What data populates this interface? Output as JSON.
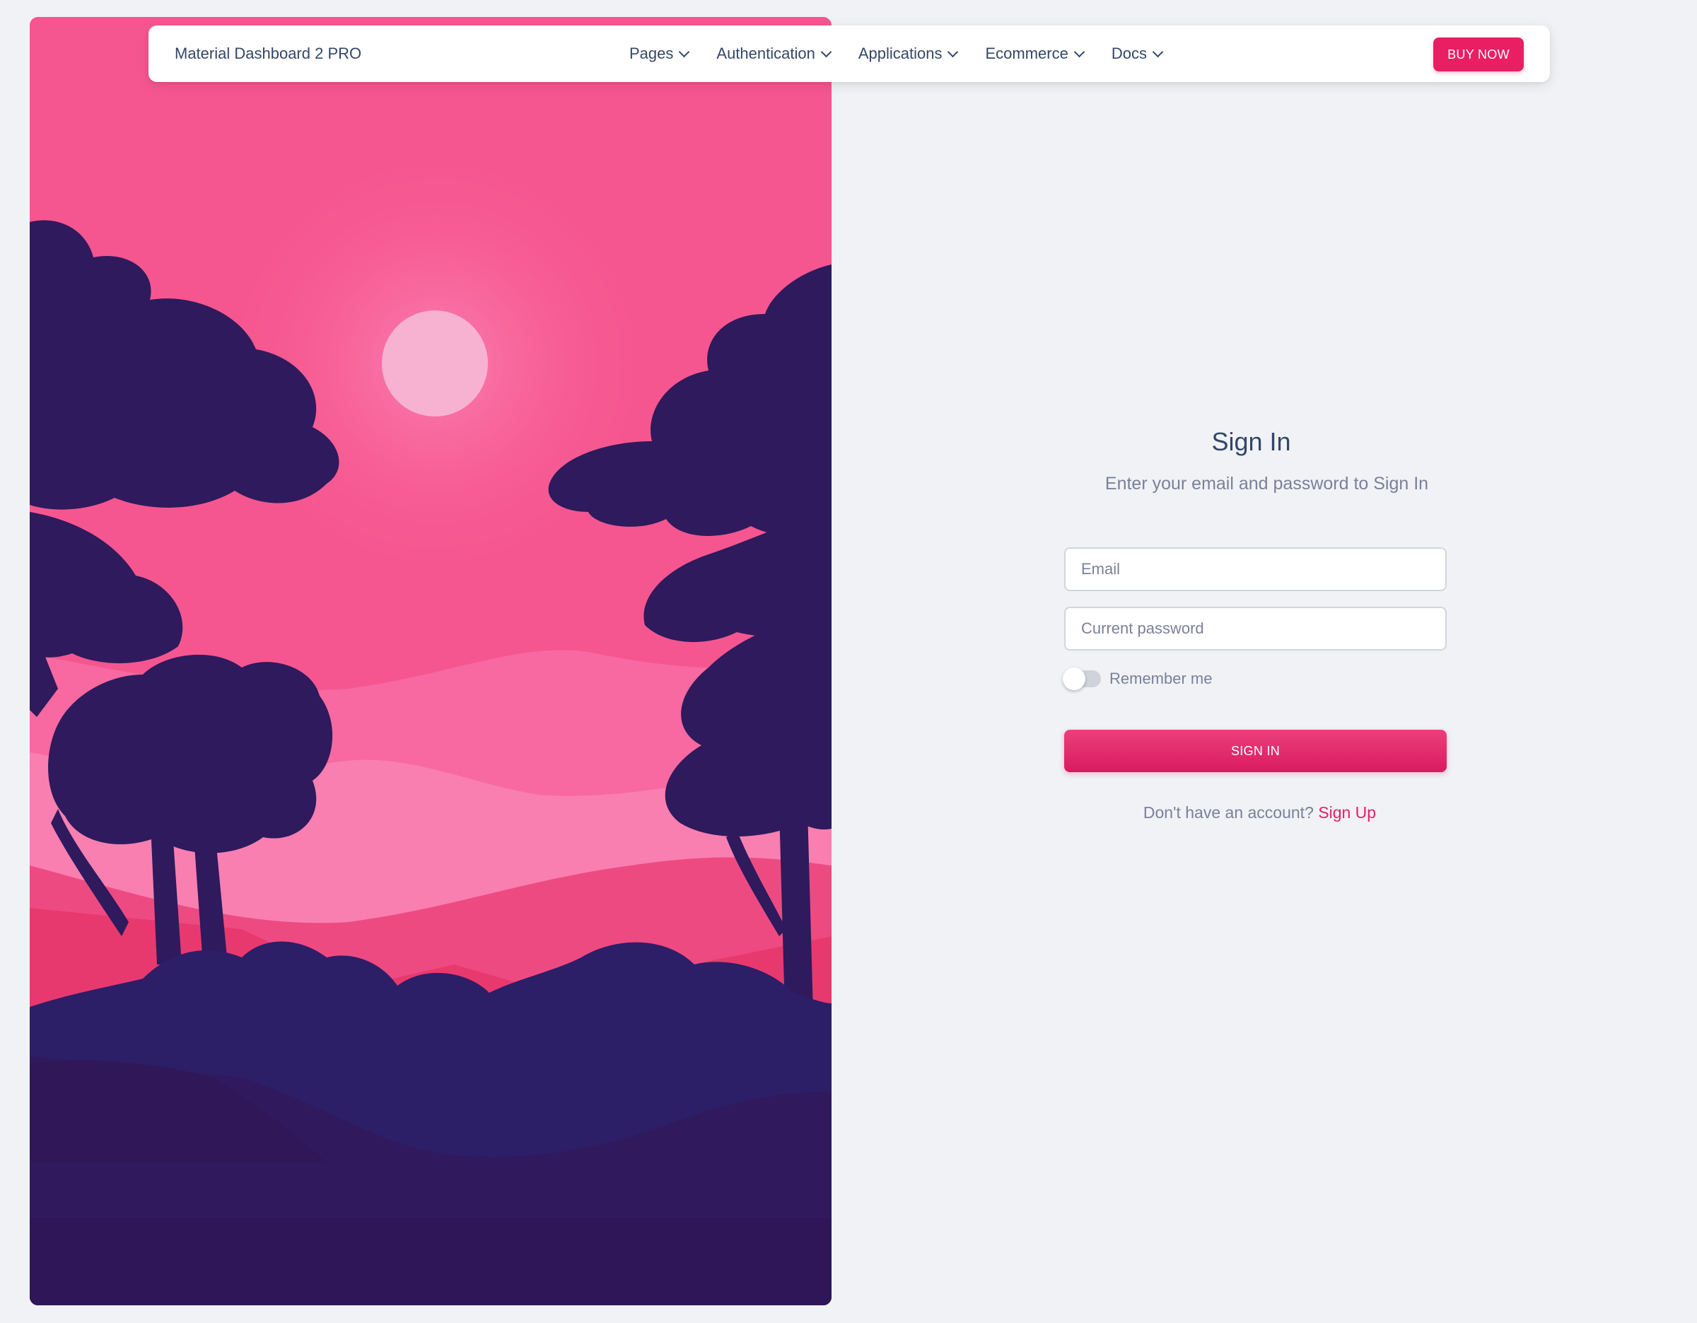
{
  "navbar": {
    "brand": "Material Dashboard 2 PRO",
    "links": [
      {
        "label": "Pages"
      },
      {
        "label": "Authentication"
      },
      {
        "label": "Applications"
      },
      {
        "label": "Ecommerce"
      },
      {
        "label": "Docs"
      }
    ],
    "buy_label": "BUY NOW"
  },
  "signin": {
    "title": "Sign In",
    "subtitle": "Enter your email and password to Sign In",
    "email_placeholder": "Email",
    "email_value": "",
    "password_placeholder": "Current password",
    "password_value": "",
    "remember_label": "Remember me",
    "remember_checked": false,
    "submit_label": "SIGN IN",
    "no_account_text": "Don't have an account?",
    "signup_label": "Sign Up"
  },
  "icons": {
    "nav_dropdown": "chevron-down-icon"
  },
  "colors": {
    "accent": "#e91e63",
    "page_background": "#f0f2f5",
    "text_dark": "#344767",
    "text_muted": "#7b809a",
    "illustration_sky": "#f6568f",
    "illustration_trees": "#2e1a5c"
  }
}
